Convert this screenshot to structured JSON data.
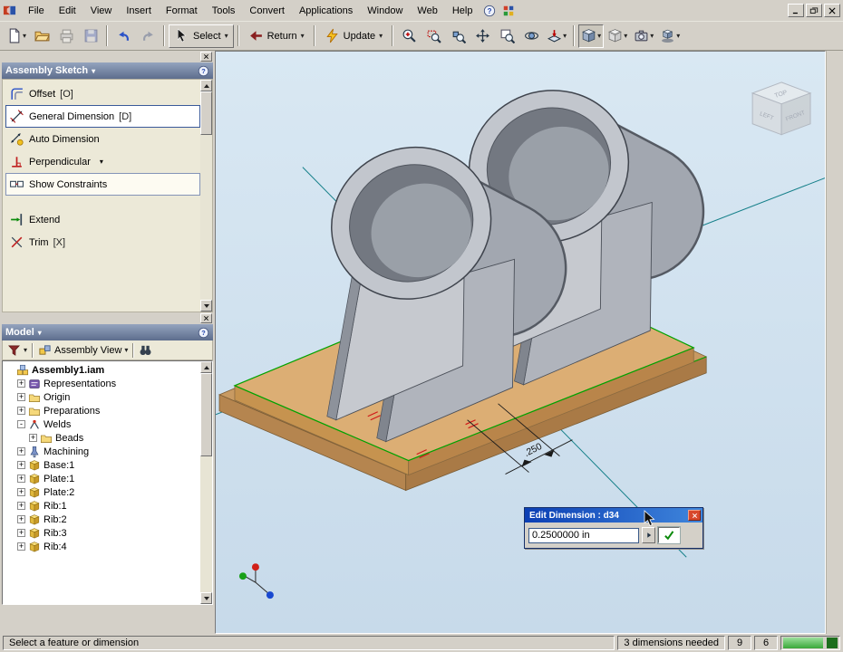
{
  "menu": {
    "items": [
      "File",
      "Edit",
      "View",
      "Insert",
      "Format",
      "Tools",
      "Convert",
      "Applications",
      "Window",
      "Web",
      "Help"
    ]
  },
  "toolbar": {
    "caret_glyph": "▾",
    "select": {
      "label": "Select"
    },
    "return": {
      "label": "Return"
    },
    "update": {
      "label": "Update"
    },
    "file_buttons": [
      {
        "icon": "new-document",
        "caret": "▾",
        "state": ""
      },
      {
        "icon": "open-folder",
        "caret": "",
        "state": ""
      },
      {
        "icon": "print",
        "caret": "",
        "state": "disabled"
      },
      {
        "icon": "save",
        "caret": "",
        "state": "disabled"
      }
    ],
    "edit_buttons": [
      {
        "icon": "undo-arrow",
        "caret": "",
        "state": ""
      },
      {
        "icon": "redo-arrow",
        "caret": "",
        "state": "disabled"
      }
    ],
    "view_buttons": [
      {
        "icon": "zoom-in",
        "caret": ""
      },
      {
        "icon": "zoom-window",
        "caret": ""
      },
      {
        "icon": "zoom-selected",
        "caret": ""
      },
      {
        "icon": "pan-hand",
        "caret": ""
      },
      {
        "icon": "zoom-all",
        "caret": ""
      },
      {
        "icon": "orbit",
        "caret": ""
      },
      {
        "icon": "look-at",
        "caret": "▾"
      }
    ],
    "display_buttons": [
      {
        "icon": "shaded-cube",
        "caret": "▾",
        "state": "pressed"
      },
      {
        "icon": "hidden-edge-cube",
        "caret": "▾",
        "state": ""
      },
      {
        "icon": "camera",
        "caret": "▾",
        "state": ""
      },
      {
        "icon": "shadow-cube",
        "caret": "▾",
        "state": ""
      }
    ]
  },
  "sketch_panel": {
    "title": "Assembly Sketch",
    "caret": "▾",
    "items": [
      {
        "label": "Offset",
        "shortcut": "[O]",
        "icon": "offset",
        "caret": "",
        "state": ""
      },
      {
        "label": "General Dimension",
        "shortcut": "[D]",
        "icon": "general-dimension",
        "caret": "",
        "state": "selected"
      },
      {
        "label": "Auto Dimension",
        "shortcut": "",
        "icon": "auto-dimension",
        "caret": "",
        "state": ""
      },
      {
        "label": "Perpendicular",
        "shortcut": "",
        "icon": "perpendicular",
        "caret": "▾",
        "state": ""
      },
      {
        "label": "Show Constraints",
        "shortcut": "",
        "icon": "show-constraints",
        "caret": "",
        "state": "active"
      },
      {
        "label": "Extend",
        "shortcut": "",
        "icon": "extend",
        "caret": "",
        "state": ""
      },
      {
        "label": "Trim",
        "shortcut": "[X]",
        "icon": "trim",
        "caret": "",
        "state": ""
      }
    ]
  },
  "model_panel": {
    "title": "Model",
    "caret": "▾",
    "view_selector": "Assembly View",
    "tree": [
      {
        "label": "Assembly1.iam",
        "level": 0,
        "exp": "",
        "icon": "assembly",
        "cls": "bold"
      },
      {
        "label": "Representations",
        "level": 1,
        "exp": "+",
        "icon": "representations",
        "cls": ""
      },
      {
        "label": "Origin",
        "level": 1,
        "exp": "+",
        "icon": "folder",
        "cls": ""
      },
      {
        "label": "Preparations",
        "level": 1,
        "exp": "+",
        "icon": "folder",
        "cls": ""
      },
      {
        "label": "Welds",
        "level": 1,
        "exp": "-",
        "icon": "welds",
        "cls": ""
      },
      {
        "label": "Beads",
        "level": 2,
        "exp": "+",
        "icon": "folder",
        "cls": ""
      },
      {
        "label": "Machining",
        "level": 1,
        "exp": "+",
        "icon": "machining",
        "cls": ""
      },
      {
        "label": "Base:1",
        "level": 1,
        "exp": "+",
        "icon": "part",
        "cls": ""
      },
      {
        "label": "Plate:1",
        "level": 1,
        "exp": "+",
        "icon": "part",
        "cls": ""
      },
      {
        "label": "Plate:2",
        "level": 1,
        "exp": "+",
        "icon": "part",
        "cls": ""
      },
      {
        "label": "Rib:1",
        "level": 1,
        "exp": "+",
        "icon": "part",
        "cls": ""
      },
      {
        "label": "Rib:2",
        "level": 1,
        "exp": "+",
        "icon": "part",
        "cls": ""
      },
      {
        "label": "Rib:3",
        "level": 1,
        "exp": "+",
        "icon": "part",
        "cls": ""
      },
      {
        "label": "Rib:4",
        "level": 1,
        "exp": "+",
        "icon": "part",
        "cls": ""
      }
    ]
  },
  "viewport": {
    "dimension_label": ".250",
    "viewcube": {
      "top": "TOP",
      "left": "LEFT",
      "front": "FRONT"
    }
  },
  "dialog": {
    "title": "Edit Dimension : d34",
    "value": "0.2500000 in"
  },
  "statusbar": {
    "message": "Select a feature or dimension",
    "dimensions_needed": "3 dimensions needed",
    "count1": "9",
    "count2": "6"
  },
  "colors": {
    "viewport_bg": "#cfe0ec",
    "base_tan": "#dcae74",
    "steel_grey": "#b6bac2",
    "axis_teal": "#16808a",
    "sketch_green": "#00a400",
    "dialog_title_blue": "#0c3fb4"
  }
}
